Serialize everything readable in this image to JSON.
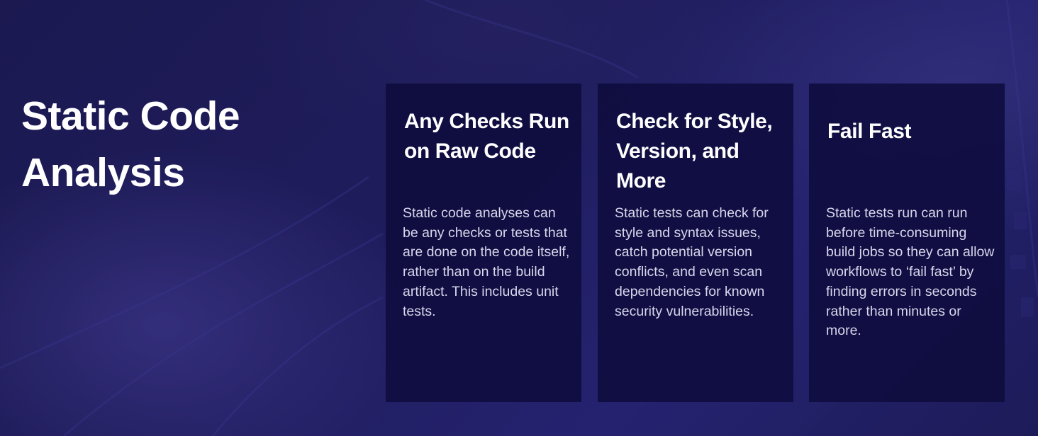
{
  "slide": {
    "title": "Static Code Analysis",
    "cards": [
      {
        "heading": "Any Checks Run on Raw Code",
        "body": "Static code analyses can be any checks or tests that are done on the code itself, rather than on the build artifact. This includes unit tests."
      },
      {
        "heading": "Check for Style, Version, and More",
        "body": "Static tests can check for style and syntax issues, catch potential version conflicts, and even scan dependencies for known security vulnerabilities."
      },
      {
        "heading": "Fail Fast",
        "body": "Static tests run can run before time-consuming build jobs so they can allow workflows to ‘fail fast’ by finding errors in seconds rather than minutes or more."
      }
    ]
  },
  "colors": {
    "background": "#1c1a55",
    "card": "#0e0c3e",
    "heading_text": "#ffffff",
    "body_text": "#d8d7ec"
  }
}
